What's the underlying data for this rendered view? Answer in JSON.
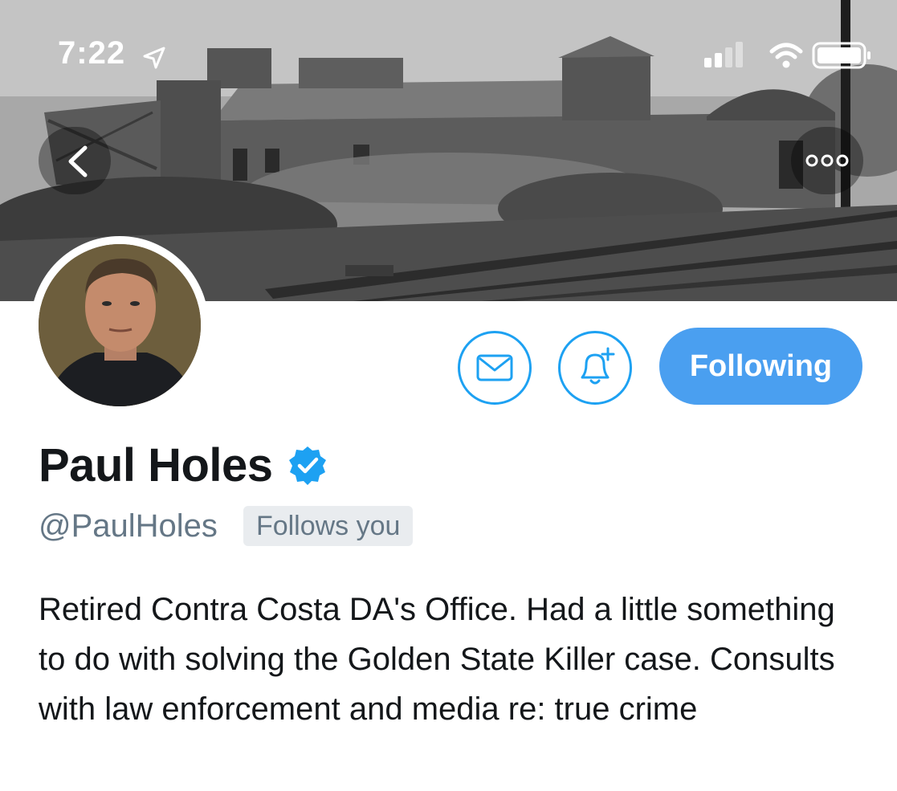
{
  "status_bar": {
    "time": "7:22",
    "icons": [
      "location-arrow-icon",
      "cellular-signal-icon",
      "wifi-icon",
      "battery-icon"
    ]
  },
  "header": {
    "back_icon": "chevron-left-icon",
    "more_icon": "more-options-icon"
  },
  "actions": {
    "message_icon": "mail-icon",
    "notify_icon": "bell-plus-icon",
    "following_label": "Following"
  },
  "profile": {
    "name": "Paul Holes",
    "verified_icon": "verified-badge-icon",
    "handle": "@PaulHoles",
    "follows_you_label": "Follows you",
    "bio": "Retired Contra Costa DA's Office. Had a little something to do with solving the Golden State Killer case. Consults with law enforcement and media re: true crime"
  },
  "colors": {
    "accent": "#1da1f2",
    "following_bg": "#4a9ff0",
    "secondary_text": "#657786",
    "badge_bg": "#e9ecef"
  }
}
